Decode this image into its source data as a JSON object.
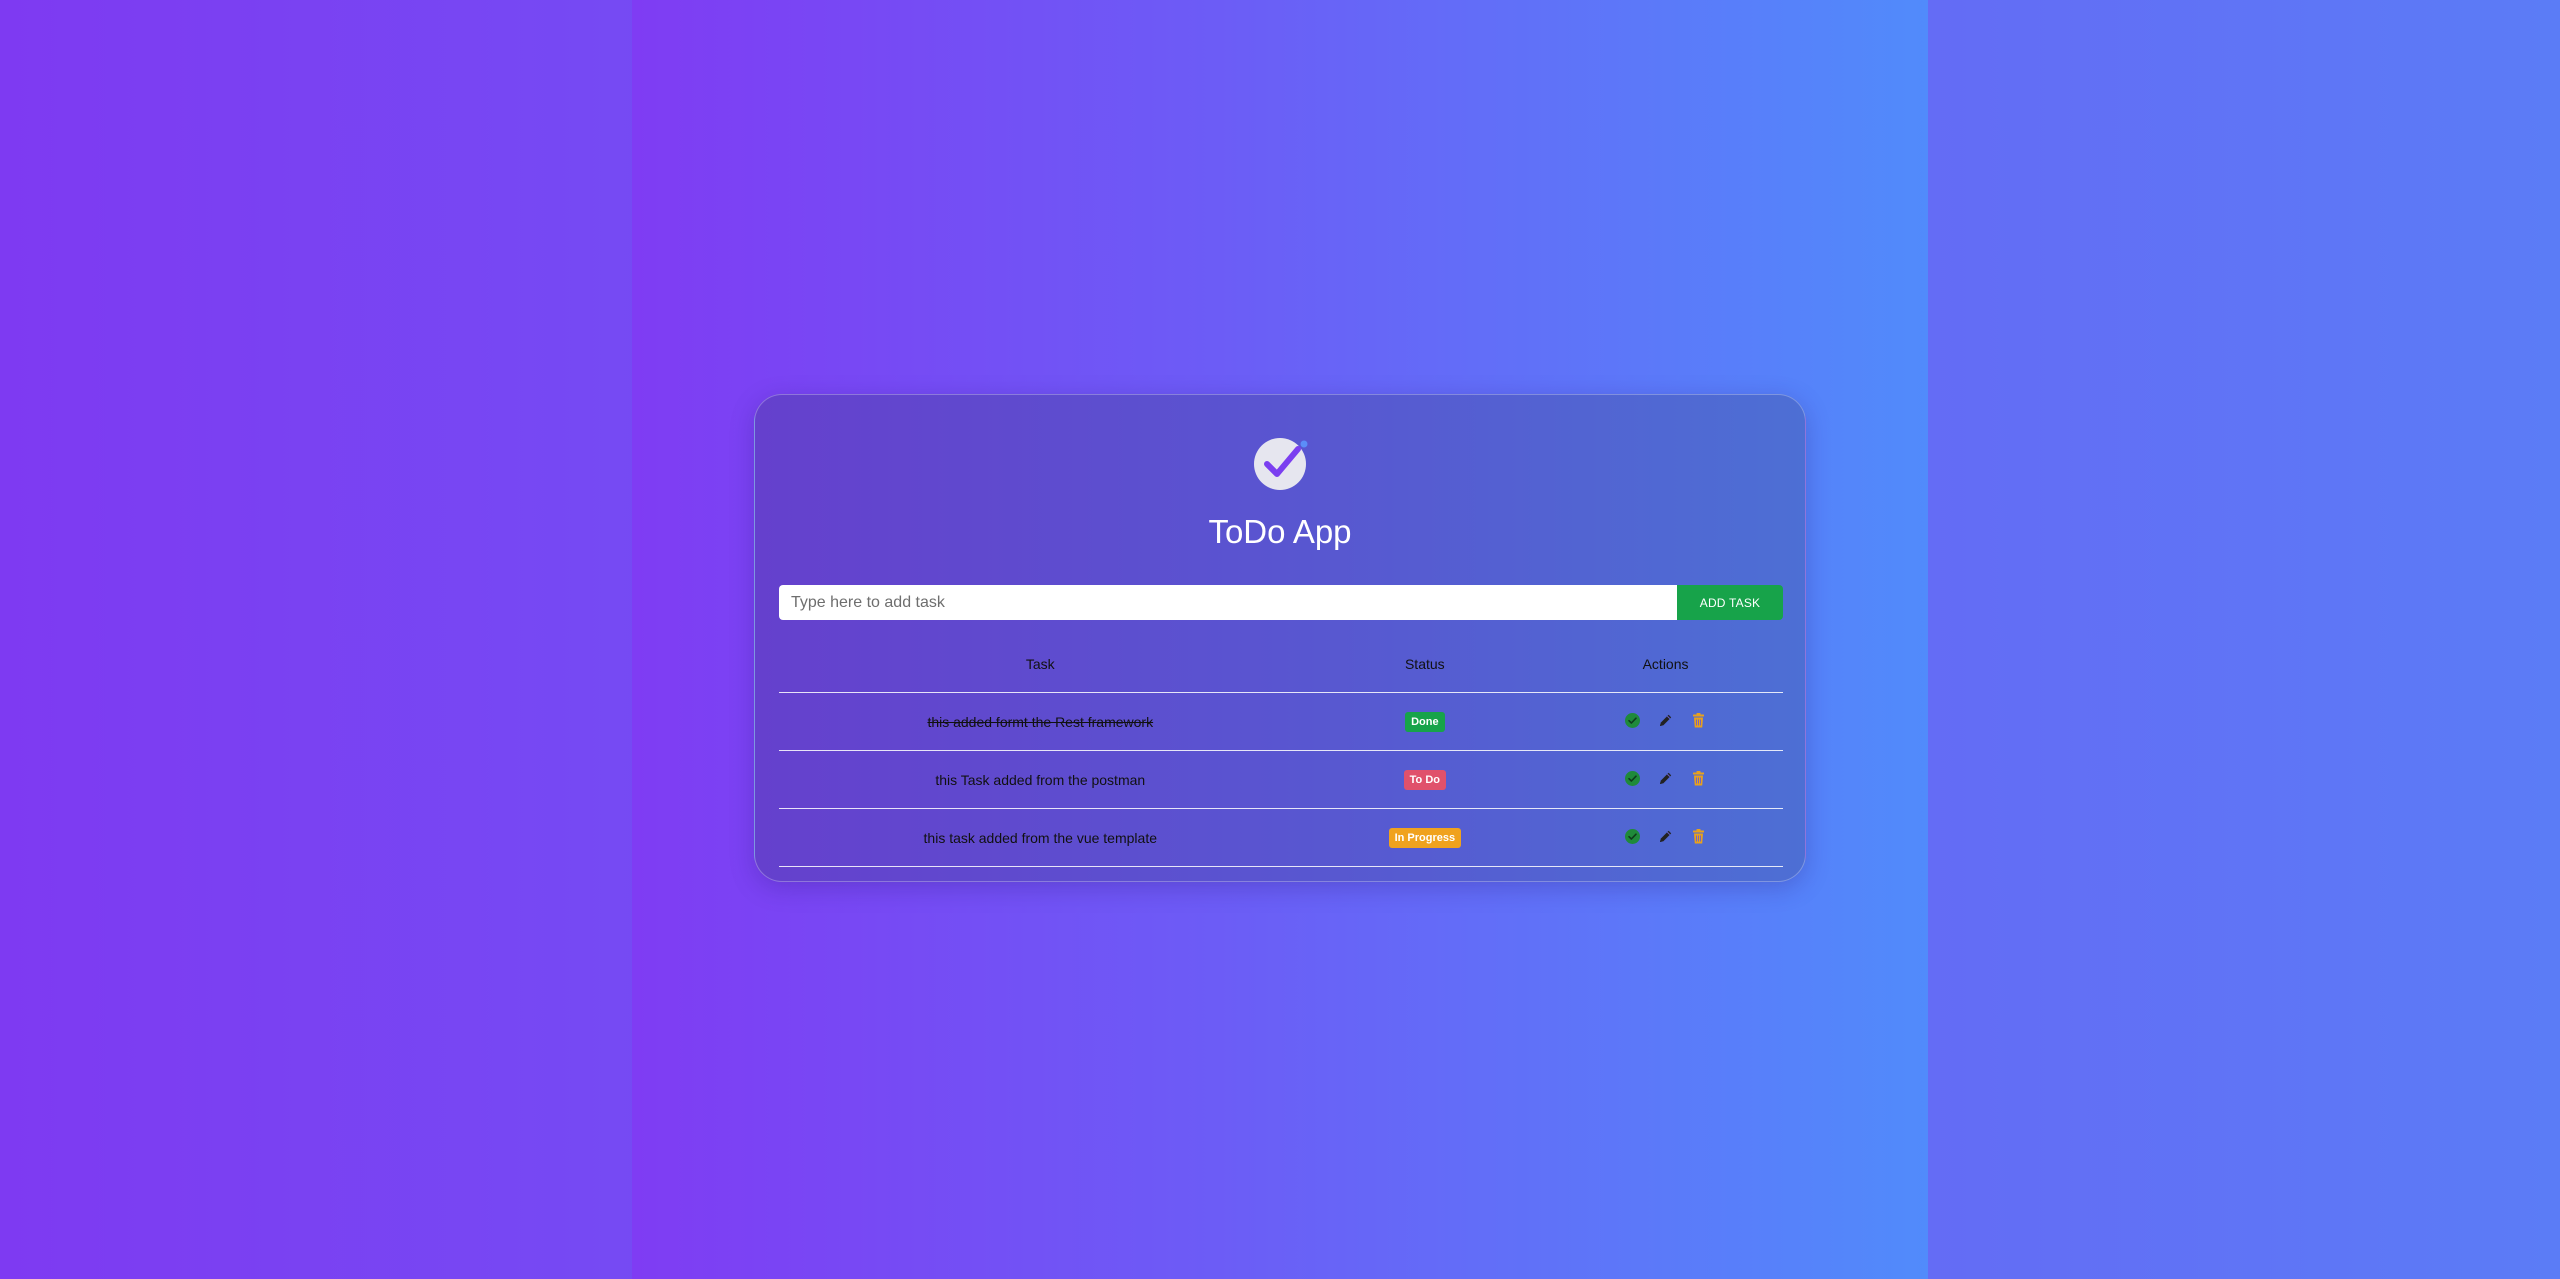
{
  "app": {
    "title": "ToDo App"
  },
  "add_task": {
    "placeholder": "Type here to add task",
    "button_label": "ADD TASK"
  },
  "table": {
    "headers": {
      "task": "Task",
      "status": "Status",
      "actions": "Actions"
    },
    "rows": [
      {
        "task": "this added formt the Rest framework",
        "status": "Done",
        "status_color": "#17a34a",
        "completed": true
      },
      {
        "task": "this Task added from the postman",
        "status": "To Do",
        "status_color": "#e0516b",
        "completed": false
      },
      {
        "task": "this task added from the vue template",
        "status": "In Progress",
        "status_color": "#f0a21e",
        "completed": false
      }
    ],
    "row_actions": [
      "check-circle-icon",
      "pencil-icon",
      "trash-icon"
    ]
  },
  "colors": {
    "accent_green": "#17a34a",
    "action_check": "#1f8a3a",
    "action_edit": "#222222",
    "action_delete": "#e8a21c"
  }
}
